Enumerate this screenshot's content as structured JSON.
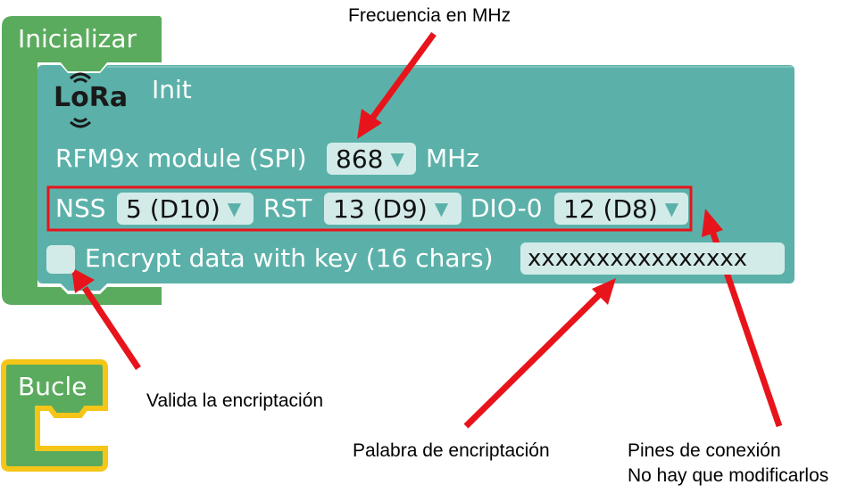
{
  "colors": {
    "event_block": "#5bab5e",
    "lora_block": "#5bb1a9",
    "dropdown_bg": "#d3ebe8",
    "highlight_red": "#e8141b",
    "loop_border": "#f5c518"
  },
  "blocks": {
    "init_event": {
      "label": "Inicializar"
    },
    "lora_init": {
      "logo_text": "LoRa",
      "title": "Init",
      "module_label": "RFM9x module (SPI)",
      "frequency_value": "868",
      "frequency_unit": "MHz",
      "nss_label": "NSS",
      "nss_value": "5 (D10)",
      "rst_label": "RST",
      "rst_value": "13 (D9)",
      "dio_label": "DIO-0",
      "dio_value": "12 (D8)",
      "encrypt_label": "Encrypt data with key (16 chars)",
      "encrypt_key": "xxxxxxxxxxxxxxxx",
      "encrypt_checked": false
    },
    "loop_event": {
      "label": "Bucle"
    }
  },
  "annotations": {
    "frequency": "Frecuencia en MHz",
    "encryption_enable": "Valida la encriptación",
    "encryption_key": "Palabra de encriptación",
    "pins_line1": "Pines de conexión",
    "pins_line2": "No hay que modificarlos"
  }
}
